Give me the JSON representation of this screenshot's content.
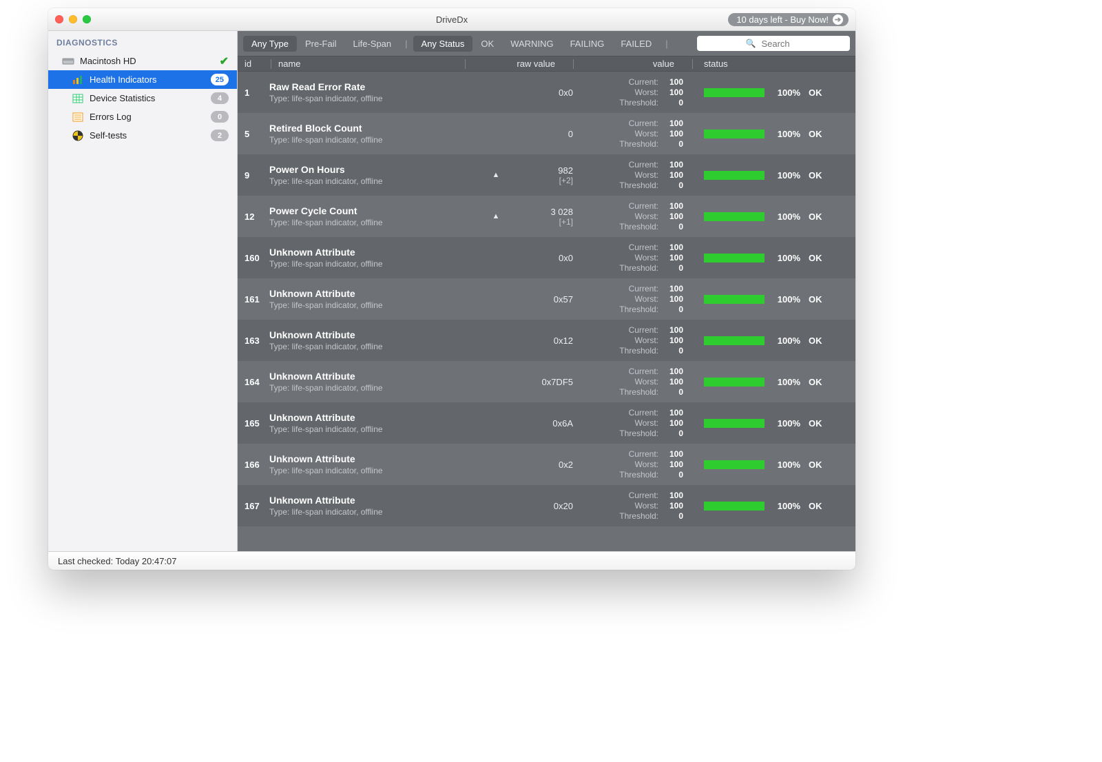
{
  "window": {
    "title": "DriveDx",
    "buy_label": "10 days left - Buy Now!"
  },
  "sidebar": {
    "heading": "DIAGNOSTICS",
    "drive": {
      "label": "Macintosh HD",
      "status": "ok"
    },
    "items": [
      {
        "icon": "bars-icon",
        "label": "Health Indicators",
        "badge": "25",
        "selected": true
      },
      {
        "icon": "grid-icon",
        "label": "Device Statistics",
        "badge": "4",
        "selected": false
      },
      {
        "icon": "list-icon",
        "label": "Errors Log",
        "badge": "0",
        "selected": false
      },
      {
        "icon": "target-icon",
        "label": "Self-tests",
        "badge": "2",
        "selected": false
      }
    ]
  },
  "filters": {
    "type": {
      "options": [
        "Any Type",
        "Pre-Fail",
        "Life-Span"
      ],
      "active": 0
    },
    "status": {
      "options": [
        "Any Status",
        "OK",
        "WARNING",
        "FAILING",
        "FAILED"
      ],
      "active": 0
    },
    "search_placeholder": "Search"
  },
  "columns": {
    "id": "id",
    "name": "name",
    "raw": "raw value",
    "value": "value",
    "status": "status"
  },
  "value_labels": {
    "current": "Current:",
    "worst": "Worst:",
    "threshold": "Threshold:"
  },
  "rows": [
    {
      "id": "1",
      "name": "Raw Read Error Rate",
      "type": "Type: life-span indicator, offline",
      "raw": "0x0",
      "raw_delta": "",
      "trend": "",
      "current": "100",
      "worst": "100",
      "threshold": "0",
      "pct": "100%",
      "status": "OK"
    },
    {
      "id": "5",
      "name": "Retired Block Count",
      "type": "Type: life-span indicator, offline",
      "raw": "0",
      "raw_delta": "",
      "trend": "",
      "current": "100",
      "worst": "100",
      "threshold": "0",
      "pct": "100%",
      "status": "OK"
    },
    {
      "id": "9",
      "name": "Power On Hours",
      "type": "Type: life-span indicator, offline",
      "raw": "982",
      "raw_delta": "[+2]",
      "trend": "up",
      "current": "100",
      "worst": "100",
      "threshold": "0",
      "pct": "100%",
      "status": "OK"
    },
    {
      "id": "12",
      "name": "Power Cycle Count",
      "type": "Type: life-span indicator, offline",
      "raw": "3 028",
      "raw_delta": "[+1]",
      "trend": "up",
      "current": "100",
      "worst": "100",
      "threshold": "0",
      "pct": "100%",
      "status": "OK"
    },
    {
      "id": "160",
      "name": "Unknown Attribute",
      "type": "Type: life-span indicator, offline",
      "raw": "0x0",
      "raw_delta": "",
      "trend": "",
      "current": "100",
      "worst": "100",
      "threshold": "0",
      "pct": "100%",
      "status": "OK"
    },
    {
      "id": "161",
      "name": "Unknown Attribute",
      "type": "Type: life-span indicator, offline",
      "raw": "0x57",
      "raw_delta": "",
      "trend": "",
      "current": "100",
      "worst": "100",
      "threshold": "0",
      "pct": "100%",
      "status": "OK"
    },
    {
      "id": "163",
      "name": "Unknown Attribute",
      "type": "Type: life-span indicator, offline",
      "raw": "0x12",
      "raw_delta": "",
      "trend": "",
      "current": "100",
      "worst": "100",
      "threshold": "0",
      "pct": "100%",
      "status": "OK"
    },
    {
      "id": "164",
      "name": "Unknown Attribute",
      "type": "Type: life-span indicator, offline",
      "raw": "0x7DF5",
      "raw_delta": "",
      "trend": "",
      "current": "100",
      "worst": "100",
      "threshold": "0",
      "pct": "100%",
      "status": "OK"
    },
    {
      "id": "165",
      "name": "Unknown Attribute",
      "type": "Type: life-span indicator, offline",
      "raw": "0x6A",
      "raw_delta": "",
      "trend": "",
      "current": "100",
      "worst": "100",
      "threshold": "0",
      "pct": "100%",
      "status": "OK"
    },
    {
      "id": "166",
      "name": "Unknown Attribute",
      "type": "Type: life-span indicator, offline",
      "raw": "0x2",
      "raw_delta": "",
      "trend": "",
      "current": "100",
      "worst": "100",
      "threshold": "0",
      "pct": "100%",
      "status": "OK"
    },
    {
      "id": "167",
      "name": "Unknown Attribute",
      "type": "Type: life-span indicator, offline",
      "raw": "0x20",
      "raw_delta": "",
      "trend": "",
      "current": "100",
      "worst": "100",
      "threshold": "0",
      "pct": "100%",
      "status": "OK"
    }
  ],
  "statusbar": {
    "last_checked": "Last checked: Today 20:47:07"
  }
}
